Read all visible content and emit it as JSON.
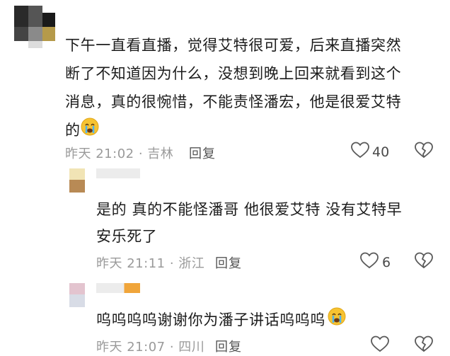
{
  "comments": [
    {
      "lines": [
        "下午一直看直播，觉得艾特很可爱，后来直播突然",
        "断了不知道因为什么，没想到晚上回来就看到这个",
        "消息，真的很惋惜，不能责怪潘宏，他是很爱艾特",
        "的"
      ],
      "emoji": "crying-face-emoji",
      "time_location": "昨天 21:02 · 吉林",
      "reply_label": "回复",
      "like_count": "40"
    },
    {
      "lines": [
        "是的 真的不能怪潘哥 他很爱艾特 没有艾特早",
        "安乐死了"
      ],
      "time_location": "昨天 21:11 · 浙江",
      "reply_label": "回复",
      "like_count": "6"
    },
    {
      "lines": [
        "呜呜呜呜谢谢你为潘子讲话呜呜呜"
      ],
      "emoji": "crying-face-emoji",
      "time_location": "昨天 21:07 · 四川",
      "reply_label": "回复"
    }
  ],
  "colors": {
    "text": "#1c1c1c",
    "meta": "#9a9a9a",
    "icon": "#5a5a5a"
  }
}
